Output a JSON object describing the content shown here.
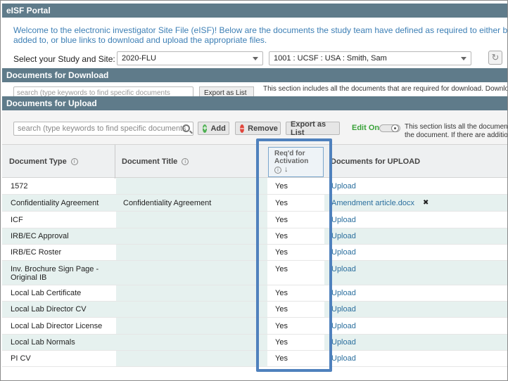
{
  "portal": {
    "title": "eISF Portal"
  },
  "welcome": {
    "text": "Welcome to the electronic investigator Site File (eISF)! Below are the documents the study team have defined as required to either be added to, or blue links to download and upload the appropriate files."
  },
  "study": {
    "label": "Select your Study and Site:",
    "study_value": "2020-FLU",
    "site_value": "1001 : UCSF : USA : Smith, Sam"
  },
  "download": {
    "title": "Documents for Download",
    "search_placeholder": "search (type keywords to find specific documents",
    "export_label": "Export as List",
    "description": "This section includes all the documents that are required for download. Download"
  },
  "upload": {
    "title": "Documents for Upload",
    "search_placeholder": "search (type keywords to find specific documents",
    "add_label": "Add",
    "remove_label": "Remove",
    "export_label": "Export as List",
    "edit_on_label": "Edit On",
    "description_line1": "This section lists all the documents",
    "description_line2": "the document. If there are addition"
  },
  "table": {
    "headers": {
      "type": "Document Type",
      "title": "Document Title",
      "req_line1": "Req'd for",
      "req_line2": "Activation",
      "docs": "Documents for UPLOAD"
    },
    "rows": [
      {
        "type": "1572",
        "title": "",
        "req": "Yes",
        "doc": "Upload"
      },
      {
        "type": "Confidentiality Agreement",
        "title": "Confidentiality Agreement",
        "req": "Yes",
        "doc": "Amendment article.docx"
      },
      {
        "type": "ICF",
        "title": "",
        "req": "Yes",
        "doc": "Upload"
      },
      {
        "type": "IRB/EC Approval",
        "title": "",
        "req": "Yes",
        "doc": "Upload"
      },
      {
        "type": "IRB/EC Roster",
        "title": "",
        "req": "Yes",
        "doc": "Upload"
      },
      {
        "type": "Inv. Brochure Sign Page - Original IB",
        "title": "",
        "req": "Yes",
        "doc": "Upload"
      },
      {
        "type": "Local Lab Certificate",
        "title": "",
        "req": "Yes",
        "doc": "Upload"
      },
      {
        "type": "Local Lab Director CV",
        "title": "",
        "req": "Yes",
        "doc": "Upload"
      },
      {
        "type": "Local Lab Director License",
        "title": "",
        "req": "Yes",
        "doc": "Upload"
      },
      {
        "type": "Local Lab Normals",
        "title": "",
        "req": "Yes",
        "doc": "Upload"
      },
      {
        "type": "PI CV",
        "title": "",
        "req": "Yes",
        "doc": "Upload"
      }
    ]
  },
  "icons": {
    "refresh": "refresh-icon",
    "search": "search-icon",
    "add": "plus-circle-icon",
    "remove": "minus-circle-icon",
    "info": "info-icon",
    "sort": "arrow-down-icon",
    "delete": "close-icon"
  },
  "colors": {
    "header_bar": "#5f7b8a",
    "link": "#2b6f9e",
    "edit_on": "#3aa23a",
    "highlight": "#4f81bd",
    "row_alt": "#e6f1ef"
  }
}
